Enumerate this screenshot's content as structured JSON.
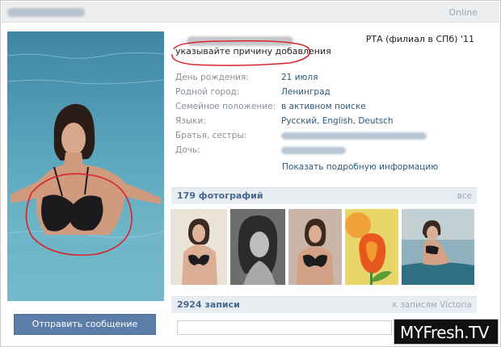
{
  "header": {
    "online": "Online"
  },
  "profile": {
    "university": "РТА (филиал в СПб) '11",
    "status": "указывайте причину добавления",
    "info_rows": [
      {
        "key": "День рождения:",
        "value": "21 июля"
      },
      {
        "key": "Родной город:",
        "value": "Ленинград"
      },
      {
        "key": "Семейное положение:",
        "value": "в активном поиске"
      },
      {
        "key": "Языки:",
        "value": "Русский, English, Deutsch"
      },
      {
        "key": "Братья, сестры:",
        "value": ""
      },
      {
        "key": "Дочь:",
        "value": ""
      }
    ],
    "more_link": "Показать подробную информацию",
    "send_message": "Отправить сообщение"
  },
  "photos": {
    "title": "179 фотографий",
    "all_link": "все"
  },
  "wall": {
    "title": "2924 записи",
    "link": "к записям Victoria"
  },
  "watermark": {
    "brand": "MYFresh.",
    "tv": "TV"
  },
  "colors": {
    "link": "#2b587a",
    "button": "#5a7ea8",
    "section_header": "#e8edf2",
    "annotation": "#d9232a"
  }
}
